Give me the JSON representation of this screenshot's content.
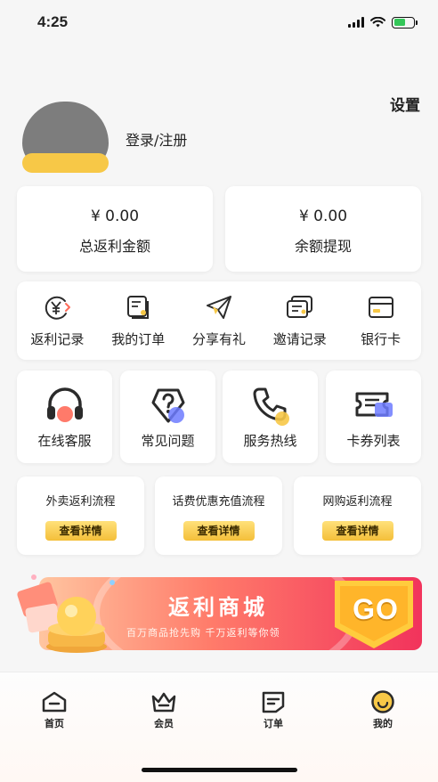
{
  "status_bar": {
    "time": "4:25"
  },
  "header": {
    "settings_label": "设置",
    "login_label": "登录/注册"
  },
  "balances": [
    {
      "value": "¥ 0.00",
      "label": "总返利金额"
    },
    {
      "value": "¥ 0.00",
      "label": "余额提现"
    }
  ],
  "quick_links": [
    {
      "label": "返利记录",
      "icon": "yen-circle-icon"
    },
    {
      "label": "我的订单",
      "icon": "order-list-icon"
    },
    {
      "label": "分享有礼",
      "icon": "paper-plane-icon"
    },
    {
      "label": "邀请记录",
      "icon": "invite-cards-icon"
    },
    {
      "label": "银行卡",
      "icon": "bank-card-icon"
    }
  ],
  "services": [
    {
      "label": "在线客服",
      "icon": "headset-icon"
    },
    {
      "label": "常见问题",
      "icon": "question-icon"
    },
    {
      "label": "服务热线",
      "icon": "phone-icon"
    },
    {
      "label": "卡券列表",
      "icon": "coupon-icon"
    }
  ],
  "flows": [
    {
      "title": "外卖返利流程",
      "button": "查看详情"
    },
    {
      "title": "话费优惠充值流程",
      "button": "查看详情"
    },
    {
      "title": "网购返利流程",
      "button": "查看详情"
    }
  ],
  "banner": {
    "title": "返利商城",
    "subtitle": "百万商品抢先购 千万返利等你领",
    "go_label": "GO"
  },
  "tabbar": [
    {
      "label": "首页",
      "icon": "home-icon"
    },
    {
      "label": "会员",
      "icon": "crown-icon"
    },
    {
      "label": "订单",
      "icon": "order-icon"
    },
    {
      "label": "我的",
      "icon": "smile-icon",
      "active": true
    }
  ],
  "colors": {
    "accent_yellow": "#f7c847",
    "accent_red": "#f2335c",
    "icon_dark": "#2b2b2b",
    "icon_accent": "#ff6b5a",
    "icon_blue": "#6d7bff"
  }
}
